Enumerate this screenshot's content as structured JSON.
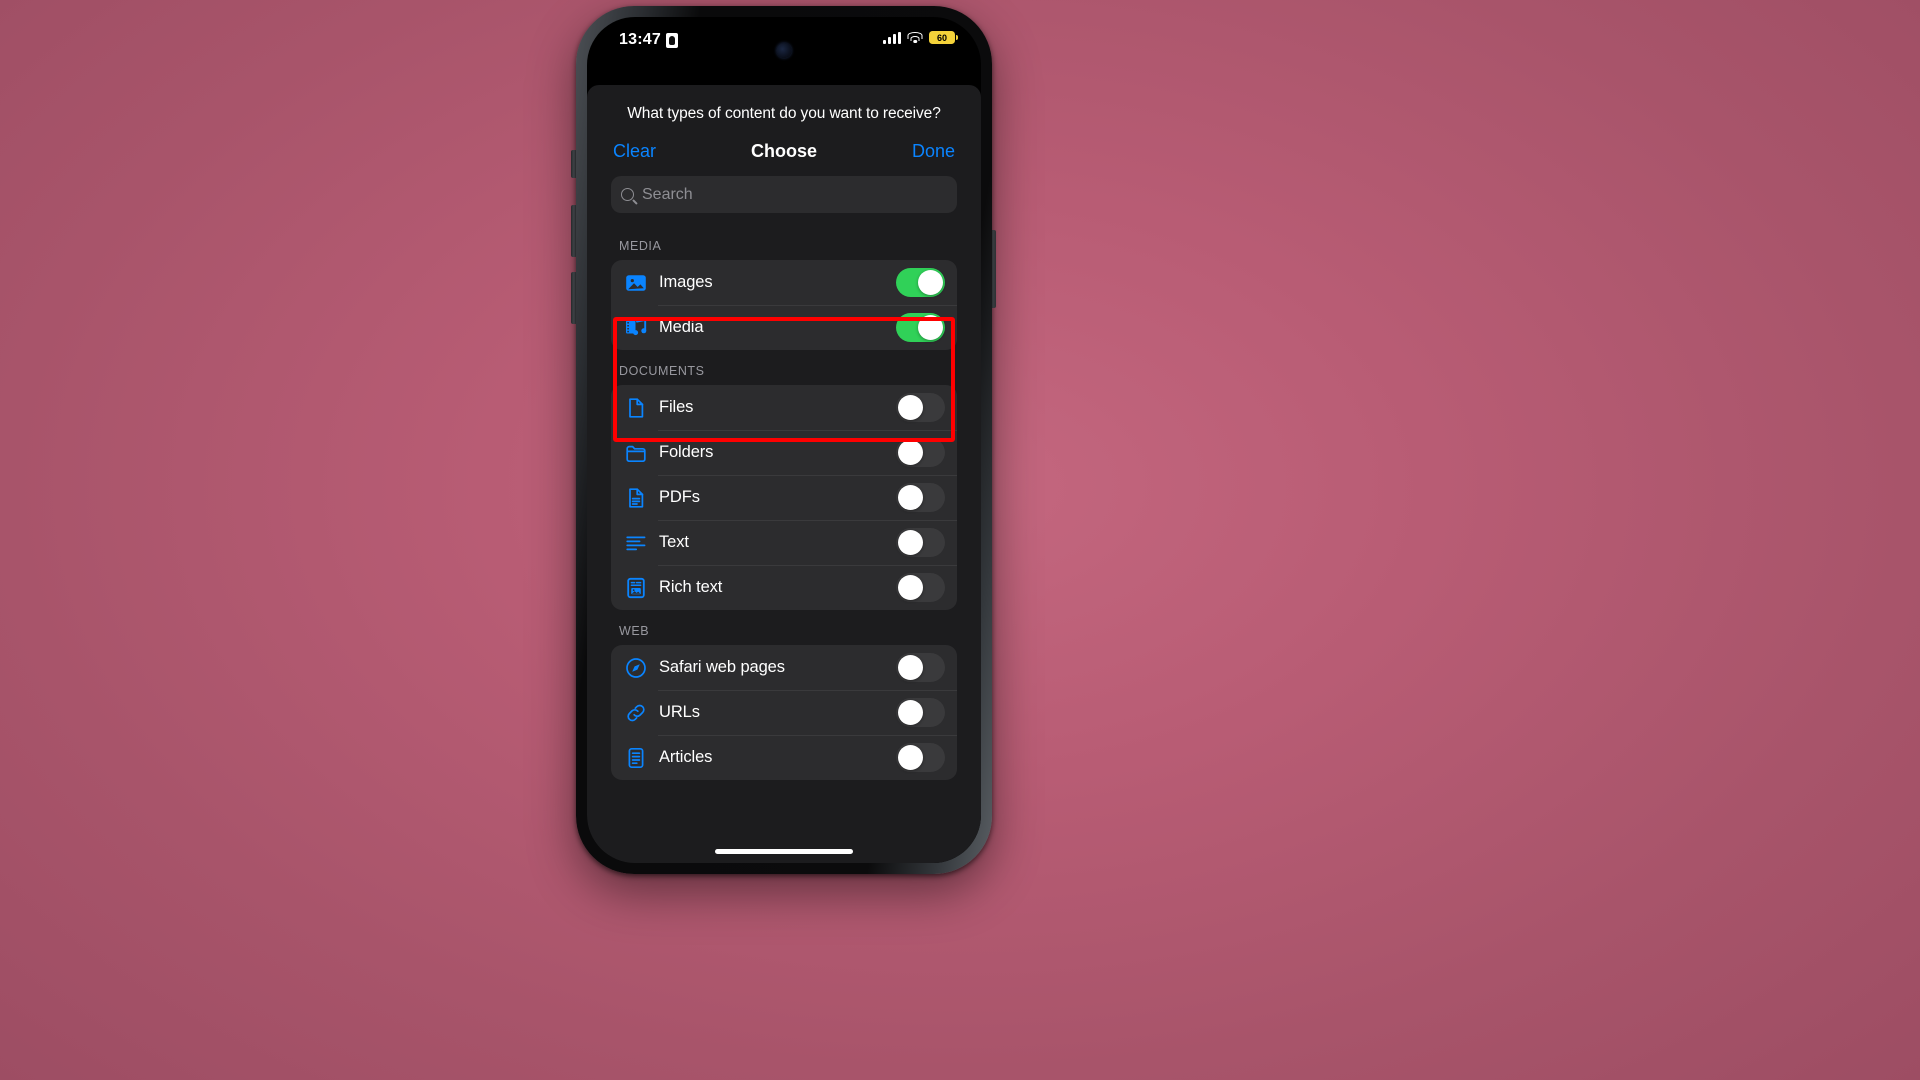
{
  "status_bar": {
    "time": "13:47",
    "lock_icon": "portrait-lock-icon",
    "signal_icon": "cellular-bars-icon",
    "wifi_icon": "wifi-icon",
    "battery_level": "60",
    "battery_color": "#f5d33a"
  },
  "sheet": {
    "prompt": "What types of content do you want to receive?",
    "nav": {
      "clear_label": "Clear",
      "title": "Choose",
      "done_label": "Done",
      "action_color": "#0a84ff"
    },
    "search": {
      "placeholder": "Search",
      "value": "",
      "icon": "search-icon"
    }
  },
  "annotation": {
    "highlight_color": "#ff0000",
    "target_section": "MEDIA"
  },
  "colors": {
    "toggle_on": "#30d158",
    "toggle_off": "#3a3a3c",
    "row_background": "#2c2c2e",
    "sheet_background": "#1c1c1e",
    "icon_blue": "#0a84ff",
    "wallpaper": "#b85c74"
  },
  "sections": [
    {
      "header": "MEDIA",
      "items": [
        {
          "label": "Images",
          "icon": "photo-icon",
          "enabled": true,
          "state": "on"
        },
        {
          "label": "Media",
          "icon": "film-music-icon",
          "enabled": true,
          "state": "on"
        }
      ]
    },
    {
      "header": "DOCUMENTS",
      "items": [
        {
          "label": "Files",
          "icon": "document-icon",
          "enabled": false,
          "state": "off"
        },
        {
          "label": "Folders",
          "icon": "folder-icon",
          "enabled": false,
          "state": "off"
        },
        {
          "label": "PDFs",
          "icon": "pdf-document-icon",
          "enabled": false,
          "state": "off"
        },
        {
          "label": "Text",
          "icon": "text-lines-icon",
          "enabled": false,
          "state": "off"
        },
        {
          "label": "Rich text",
          "icon": "rich-text-doc-icon",
          "enabled": false,
          "state": "off"
        }
      ]
    },
    {
      "header": "WEB",
      "items": [
        {
          "label": "Safari web pages",
          "icon": "safari-compass-icon",
          "enabled": false,
          "state": "off"
        },
        {
          "label": "URLs",
          "icon": "link-icon",
          "enabled": false,
          "state": "off"
        },
        {
          "label": "Articles",
          "icon": "article-icon",
          "enabled": false,
          "state": "off"
        }
      ]
    }
  ]
}
